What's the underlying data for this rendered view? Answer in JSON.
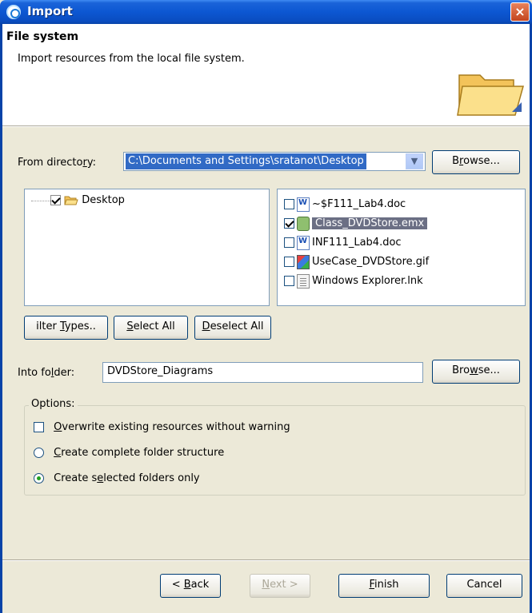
{
  "window": {
    "title": "Import",
    "close_symbol": "×"
  },
  "header": {
    "title": "File system",
    "description": "Import resources from the local file system."
  },
  "from_directory": {
    "label_pre": "From directo",
    "label_u": "r",
    "label_post": "y:",
    "value": "C:\\Documents and Settings\\sratanot\\Desktop",
    "arrow": "▼",
    "browse_label": "B",
    "browse_u": "r",
    "browse_post": "owse..."
  },
  "tree": {
    "items": [
      {
        "label": "Desktop",
        "checked": true
      }
    ]
  },
  "files": [
    {
      "name": "~$F111_Lab4.doc",
      "checked": false,
      "icon": "word-doc-icon",
      "selected": false
    },
    {
      "name": "Class_DVDStore.emx",
      "checked": true,
      "icon": "emx-icon",
      "selected": true
    },
    {
      "name": "INF111_Lab4.doc",
      "checked": false,
      "icon": "word-doc-icon",
      "selected": false
    },
    {
      "name": "UseCase_DVDStore.gif",
      "checked": false,
      "icon": "gif-image-icon",
      "selected": false
    },
    {
      "name": "Windows Explorer.lnk",
      "checked": false,
      "icon": "shortcut-icon",
      "selected": false
    }
  ],
  "selection_buttons": {
    "filter_pre": "ilter ",
    "filter_u": "T",
    "filter_post": "ypes..",
    "select_u": "S",
    "select_post": "elect All",
    "deselect_u": "D",
    "deselect_post": "eselect All"
  },
  "into_folder": {
    "label_pre": "Into fo",
    "label_u": "l",
    "label_post": "der:",
    "value": "DVDStore_Diagrams",
    "browse_pre": "Bro",
    "browse_u": "w",
    "browse_post": "se..."
  },
  "options": {
    "legend": "Options:",
    "overwrite_u": "O",
    "overwrite_post": "verwrite existing resources without warning",
    "overwrite_checked": false,
    "complete_u": "C",
    "complete_post": "reate complete folder structure",
    "selected_pre": "Create s",
    "selected_u": "e",
    "selected_post": "lected folders only",
    "selected_option": "selected_folders_only"
  },
  "footer": {
    "back_pre": "< ",
    "back_u": "B",
    "back_post": "ack",
    "next_u": "N",
    "next_post": "ext >",
    "finish_u": "F",
    "finish_post": "inish",
    "cancel": "Cancel"
  },
  "colors": {
    "titlebar": "#0a4cc0",
    "selection": "#316ac5",
    "file_selection": "#6b6f84",
    "dialog_bg": "#ece9d8"
  }
}
